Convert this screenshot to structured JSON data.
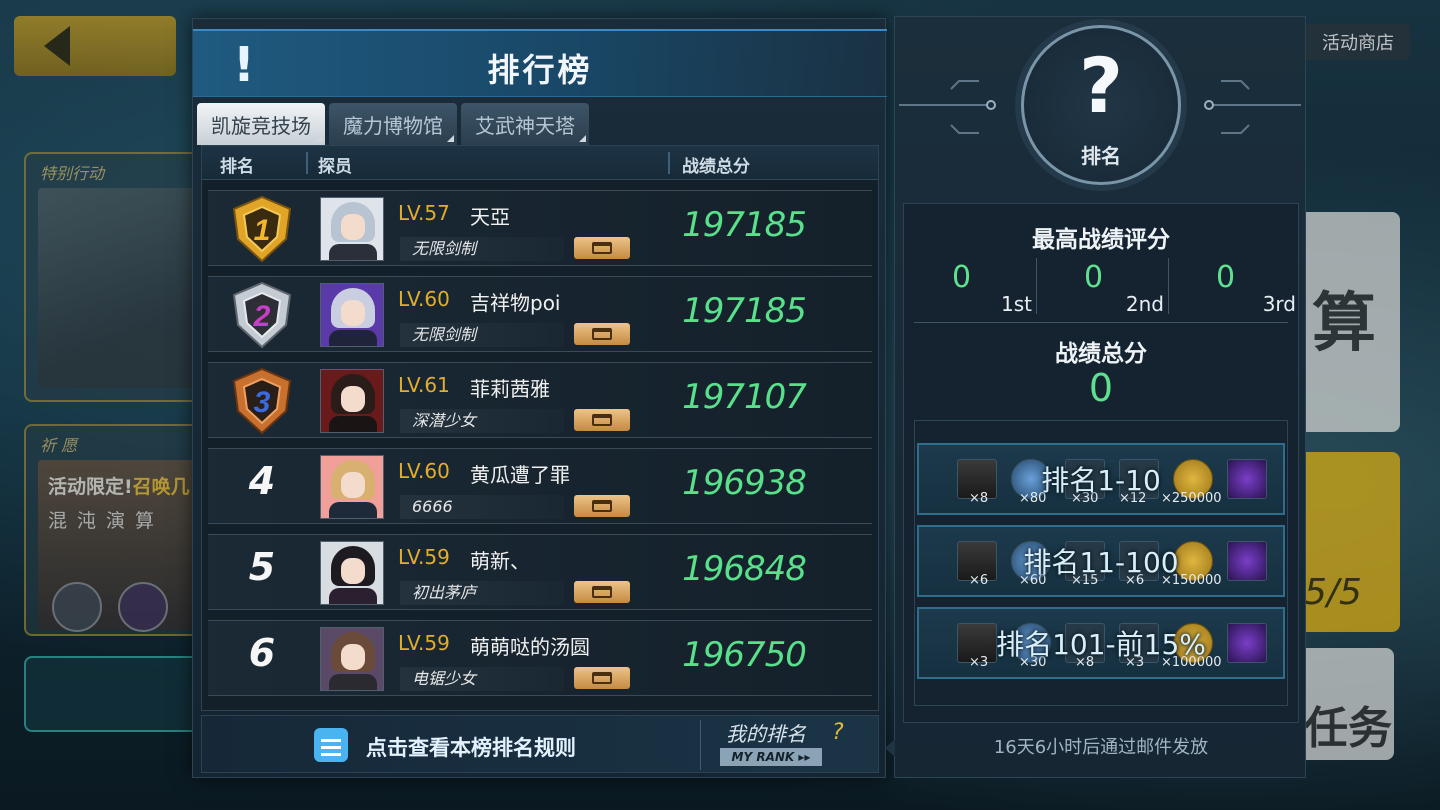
{
  "background": {
    "shop_label": "活动商店",
    "card1_label": "特别行动",
    "card2_label": "祈 愿",
    "promo_prefix": "活动限定!",
    "promo_highlight": "召唤几",
    "promo_line2": "混沌演算",
    "right_card1_text": "算",
    "right_card2_text": "5/5",
    "right_card3_text": "任务"
  },
  "header": {
    "icon_text": "!",
    "title": "排行榜"
  },
  "tabs": [
    {
      "label": "凯旋竞技场",
      "active": true
    },
    {
      "label": "魔力博物馆",
      "active": false
    },
    {
      "label": "艾武神天塔",
      "active": false
    }
  ],
  "columns": {
    "rank": "排名",
    "player": "探员",
    "score": "战绩总分"
  },
  "rows": [
    {
      "rank": "1",
      "level": "LV.57",
      "name": "天亞",
      "title": "无限剑制",
      "score": "197185",
      "medal": "gold"
    },
    {
      "rank": "2",
      "level": "LV.60",
      "name": "吉祥物poi",
      "title": "无限剑制",
      "score": "197185",
      "medal": "silver"
    },
    {
      "rank": "3",
      "level": "LV.61",
      "name": "菲莉茜雅",
      "title": "深潜少女",
      "score": "197107",
      "medal": "bronze"
    },
    {
      "rank": "4",
      "level": "LV.60",
      "name": "黄瓜遭了罪",
      "title": "6666",
      "score": "196938",
      "medal": "none"
    },
    {
      "rank": "5",
      "level": "LV.59",
      "name": "萌新、",
      "title": "初出茅庐",
      "score": "196848",
      "medal": "none"
    },
    {
      "rank": "6",
      "level": "LV.59",
      "name": "萌萌哒的汤圆",
      "title": "电锯少女",
      "score": "196750",
      "medal": "none"
    }
  ],
  "footer": {
    "rules_text": "点击查看本榜排名规则",
    "my_rank_label": "我的排名",
    "my_rank_sub": "MY RANK ▸▸",
    "help_icon": "?"
  },
  "side": {
    "emblem_symbol": "?",
    "emblem_caption": "排名",
    "best_title": "最高战绩评分",
    "best": [
      {
        "value": "0",
        "ordinal": "1st"
      },
      {
        "value": "0",
        "ordinal": "2nd"
      },
      {
        "value": "0",
        "ordinal": "3rd"
      }
    ],
    "total_title": "战绩总分",
    "total_value": "0",
    "rewards": [
      {
        "label": "排名1-10",
        "counts": [
          "×8",
          "×80",
          "×30",
          "×12",
          "×250000"
        ]
      },
      {
        "label": "排名11-100",
        "counts": [
          "×6",
          "×60",
          "×15",
          "×6",
          "×150000"
        ]
      },
      {
        "label": "排名101-前15%",
        "counts": [
          "×3",
          "×30",
          "×8",
          "×3",
          "×100000"
        ]
      }
    ],
    "mail_note": "16天6小时后通过邮件发放"
  },
  "colors": {
    "score_green": "#58e08a",
    "level_gold": "#e3ad2c",
    "gold": "#e0a526",
    "silver": "#c4cbd2",
    "bronze": "#c8702e"
  }
}
